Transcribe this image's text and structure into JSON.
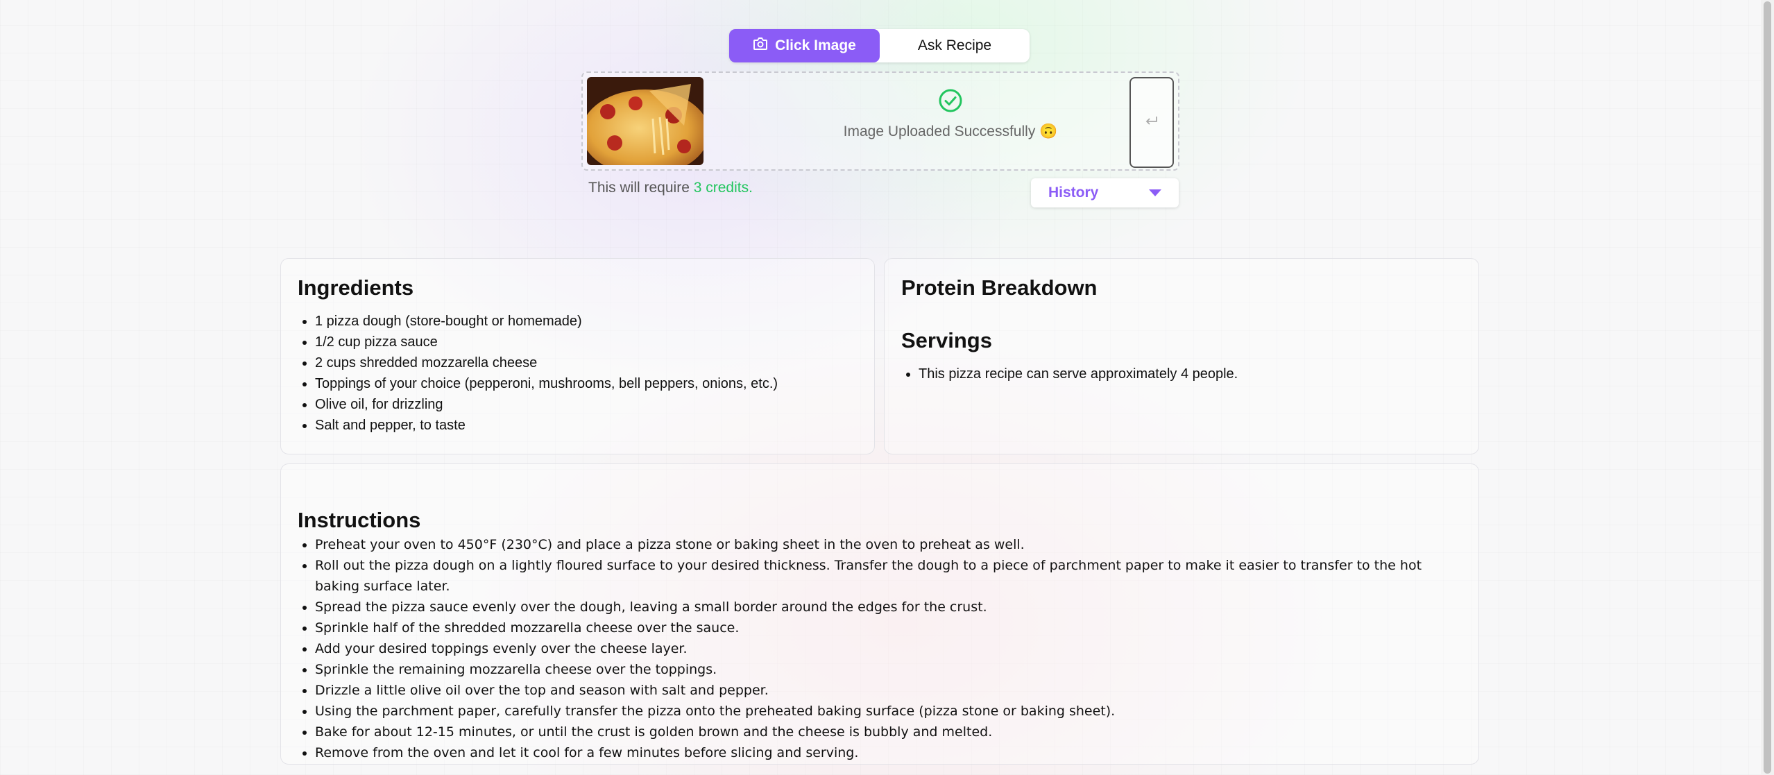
{
  "mode_toggle": {
    "active_label": "Click Image",
    "inactive_label": "Ask Recipe",
    "active_color": "#8b5cf6"
  },
  "upload": {
    "status_text": "Image Uploaded Successfully 🙃",
    "status_icon": "check-circle-icon",
    "send_icon": "enter-return-icon"
  },
  "credits": {
    "prefix": "This will require ",
    "amount": "3 credits."
  },
  "history": {
    "label": "History"
  },
  "ingredients": {
    "title": "Ingredients",
    "items": [
      "1 pizza dough (store-bought or homemade)",
      "1/2 cup pizza sauce",
      "2 cups shredded mozzarella cheese",
      "Toppings of your choice (pepperoni, mushrooms, bell peppers, onions, etc.)",
      "Olive oil, for drizzling",
      "Salt and pepper, to taste"
    ]
  },
  "protein": {
    "title": "Protein Breakdown",
    "servings_title": "Servings",
    "servings_items": [
      "This pizza recipe can serve approximately 4 people."
    ]
  },
  "instructions": {
    "title": "Instructions",
    "items": [
      "Preheat your oven to 450°F (230°C) and place a pizza stone or baking sheet in the oven to preheat as well.",
      "Roll out the pizza dough on a lightly floured surface to your desired thickness. Transfer the dough to a piece of parchment paper to make it easier to transfer to the hot baking surface later.",
      "Spread the pizza sauce evenly over the dough, leaving a small border around the edges for the crust.",
      "Sprinkle half of the shredded mozzarella cheese over the sauce.",
      "Add your desired toppings evenly over the cheese layer.",
      "Sprinkle the remaining mozzarella cheese over the toppings.",
      "Drizzle a little olive oil over the top and season with salt and pepper.",
      "Using the parchment paper, carefully transfer the pizza onto the preheated baking surface (pizza stone or baking sheet).",
      "Bake for about 12-15 minutes, or until the crust is golden brown and the cheese is bubbly and melted.",
      "Remove from the oven and let it cool for a few minutes before slicing and serving."
    ]
  }
}
